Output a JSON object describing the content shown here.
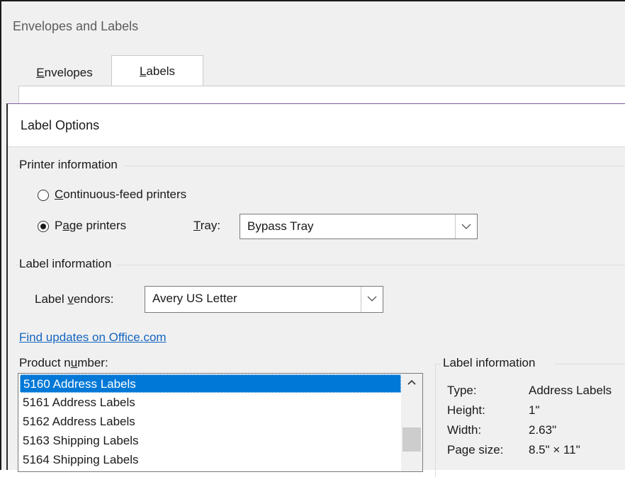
{
  "outer_dialog": {
    "title": "Envelopes and Labels",
    "tabs": [
      {
        "label_pre": "",
        "label_key": "E",
        "label_post": "nvelopes"
      },
      {
        "label_pre": "",
        "label_key": "L",
        "label_post": "abels"
      }
    ]
  },
  "label_options": {
    "title": "Label Options",
    "printer_info": {
      "group_title": "Printer information",
      "continuous_pre": "",
      "continuous_key": "C",
      "continuous_post": "ontinuous-feed printers",
      "continuous_checked": false,
      "page_pre": "P",
      "page_key": "a",
      "page_post": "ge printers",
      "page_checked": true,
      "tray_key": "T",
      "tray_post": "ray:",
      "tray_value": "Bypass Tray"
    },
    "label_info": {
      "group_title": "Label information",
      "vendors_pre": "Label ",
      "vendors_key": "v",
      "vendors_post": "endors:",
      "vendors_value": "Avery US Letter"
    },
    "find_updates_link": "Find updates on Office.com",
    "product": {
      "label_pre": "Product n",
      "label_key": "u",
      "label_post": "mber:",
      "items": [
        "5160 Address Labels",
        "5161 Address Labels",
        "5162 Address Labels",
        "5163 Shipping Labels",
        "5164 Shipping Labels"
      ],
      "selected_index": 0
    },
    "details": {
      "group_title": "Label information",
      "type_key": "Type:",
      "type_val": "Address Labels",
      "height_key": "Height:",
      "height_val": "1\"",
      "width_key": "Width:",
      "width_val": "2.63\"",
      "page_key": "Page size:",
      "page_val": "8.5\" × 11\""
    }
  }
}
